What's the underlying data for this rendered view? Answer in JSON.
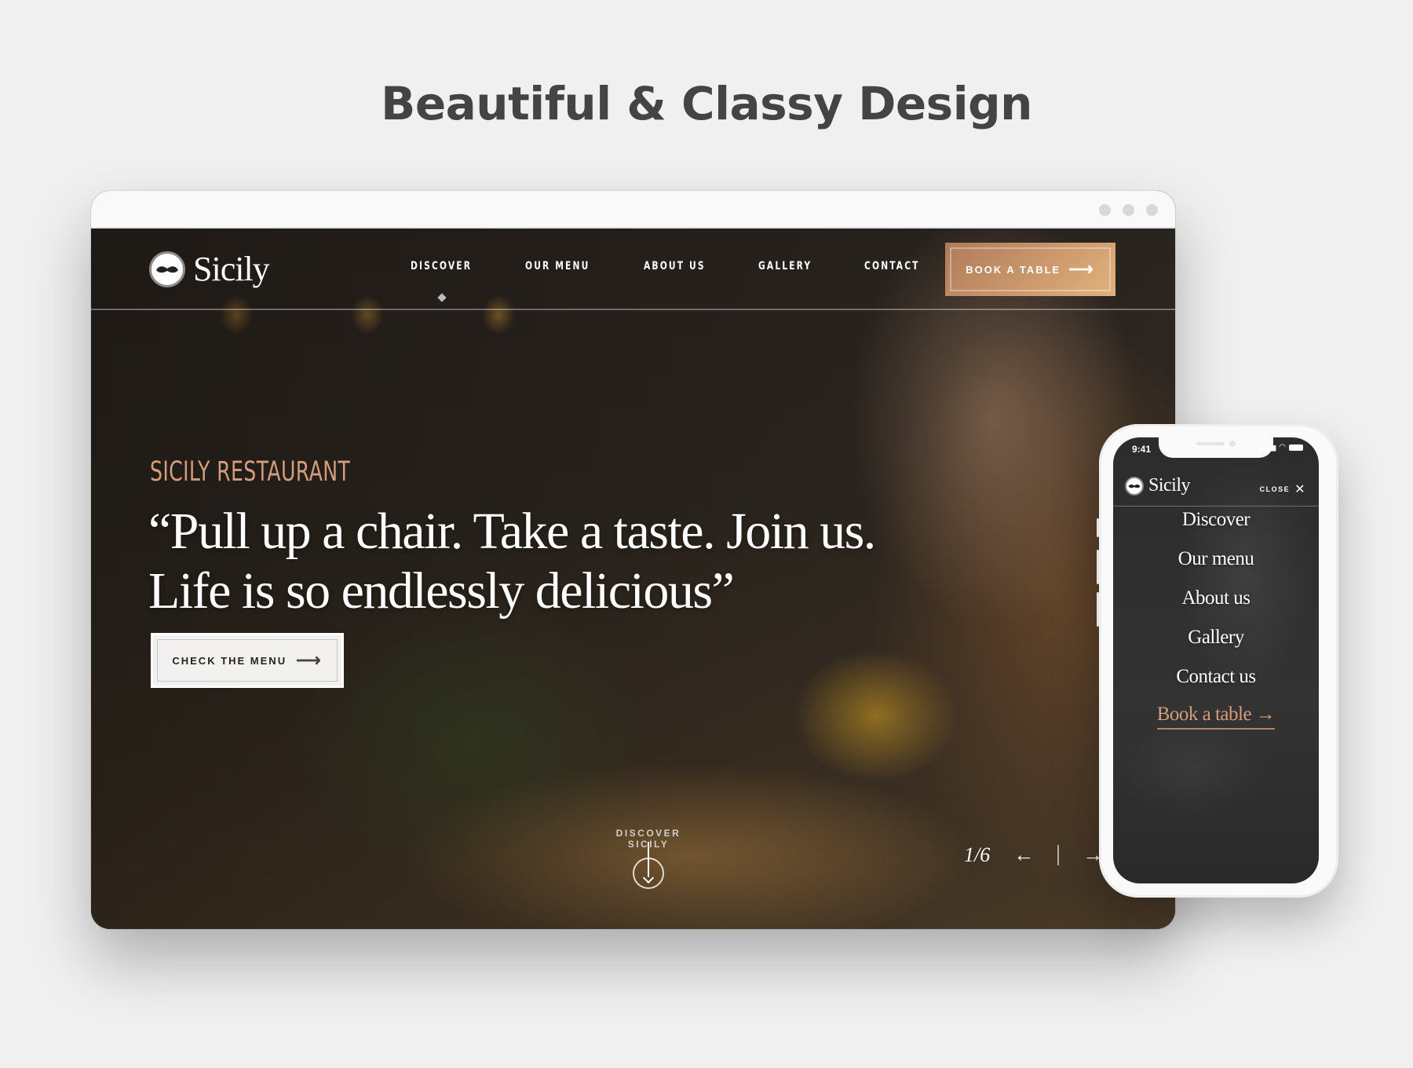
{
  "headline": "Beautiful & Classy Design",
  "desktop": {
    "window_controls": [
      "dot",
      "dot",
      "dot"
    ],
    "logo": {
      "icon": "mustache-icon",
      "text": "Sicily"
    },
    "nav": {
      "items": [
        "DISCOVER",
        "OUR MENU",
        "ABOUT US",
        "GALLERY",
        "CONTACT"
      ],
      "active_index": 0,
      "cta": {
        "label": "BOOK A TABLE",
        "icon": "arrow-right-icon"
      }
    },
    "hero": {
      "eyebrow": "SICILY RESTAURANT",
      "quote_line1": "“Pull up a chair. Take a taste. Join us.",
      "quote_line2": "Life is so endlessly delicious”",
      "button": {
        "label": "CHECK THE MENU",
        "icon": "arrow-right-icon"
      },
      "scroll_hint": {
        "label": "DISCOVER SICILY",
        "icon": "arrow-down-circle-icon"
      },
      "slider": {
        "current": "1/6",
        "prev_icon": "arrow-left-icon",
        "next_icon": "arrow-right-icon"
      }
    },
    "accent_color": "#d39c7b"
  },
  "mobile": {
    "status": {
      "time": "9:41",
      "icons": [
        "signal-icon",
        "wifi-icon",
        "battery-icon"
      ]
    },
    "logo": {
      "icon": "mustache-icon",
      "text": "Sicily"
    },
    "close": {
      "label": "CLOSE",
      "icon": "close-icon"
    },
    "menu": [
      "Discover",
      "Our menu",
      "About us",
      "Gallery",
      "Contact us"
    ],
    "cta": "Book a table →"
  }
}
